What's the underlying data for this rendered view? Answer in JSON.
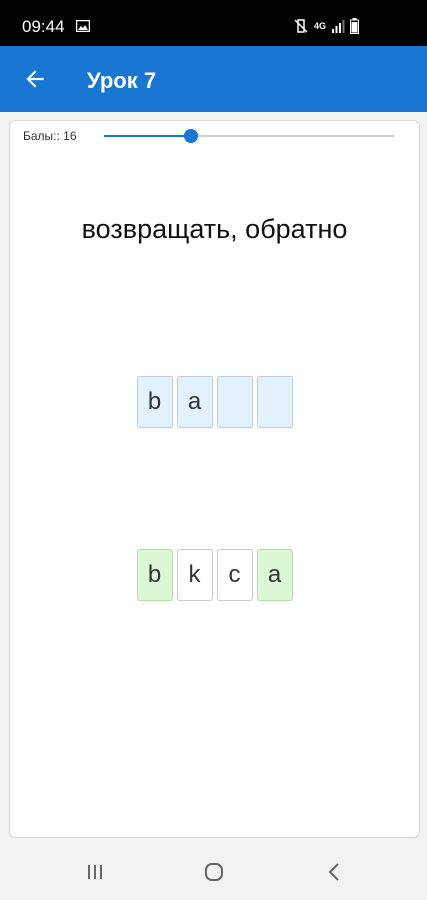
{
  "status": {
    "time": "09:44",
    "network": "4G"
  },
  "appbar": {
    "title": "Урок 7",
    "back_icon": "arrow-left-icon"
  },
  "score": {
    "label": "Балы:: 16",
    "progress": 0.3
  },
  "prompt": "возвращать, обратно",
  "answer_tiles": [
    {
      "letter": "b",
      "state": "filled"
    },
    {
      "letter": "a",
      "state": "filled"
    },
    {
      "letter": "",
      "state": "empty"
    },
    {
      "letter": "",
      "state": "empty"
    }
  ],
  "choice_tiles": [
    {
      "letter": "b",
      "state": "used"
    },
    {
      "letter": "k",
      "state": "available"
    },
    {
      "letter": "c",
      "state": "available"
    },
    {
      "letter": "a",
      "state": "used"
    }
  ],
  "colors": {
    "appbar": "#1976d2",
    "tile_blue": "#e3f1fd",
    "tile_green": "#dcf7d6"
  },
  "navbar": [
    "recent-apps-icon",
    "home-icon",
    "back-icon"
  ]
}
